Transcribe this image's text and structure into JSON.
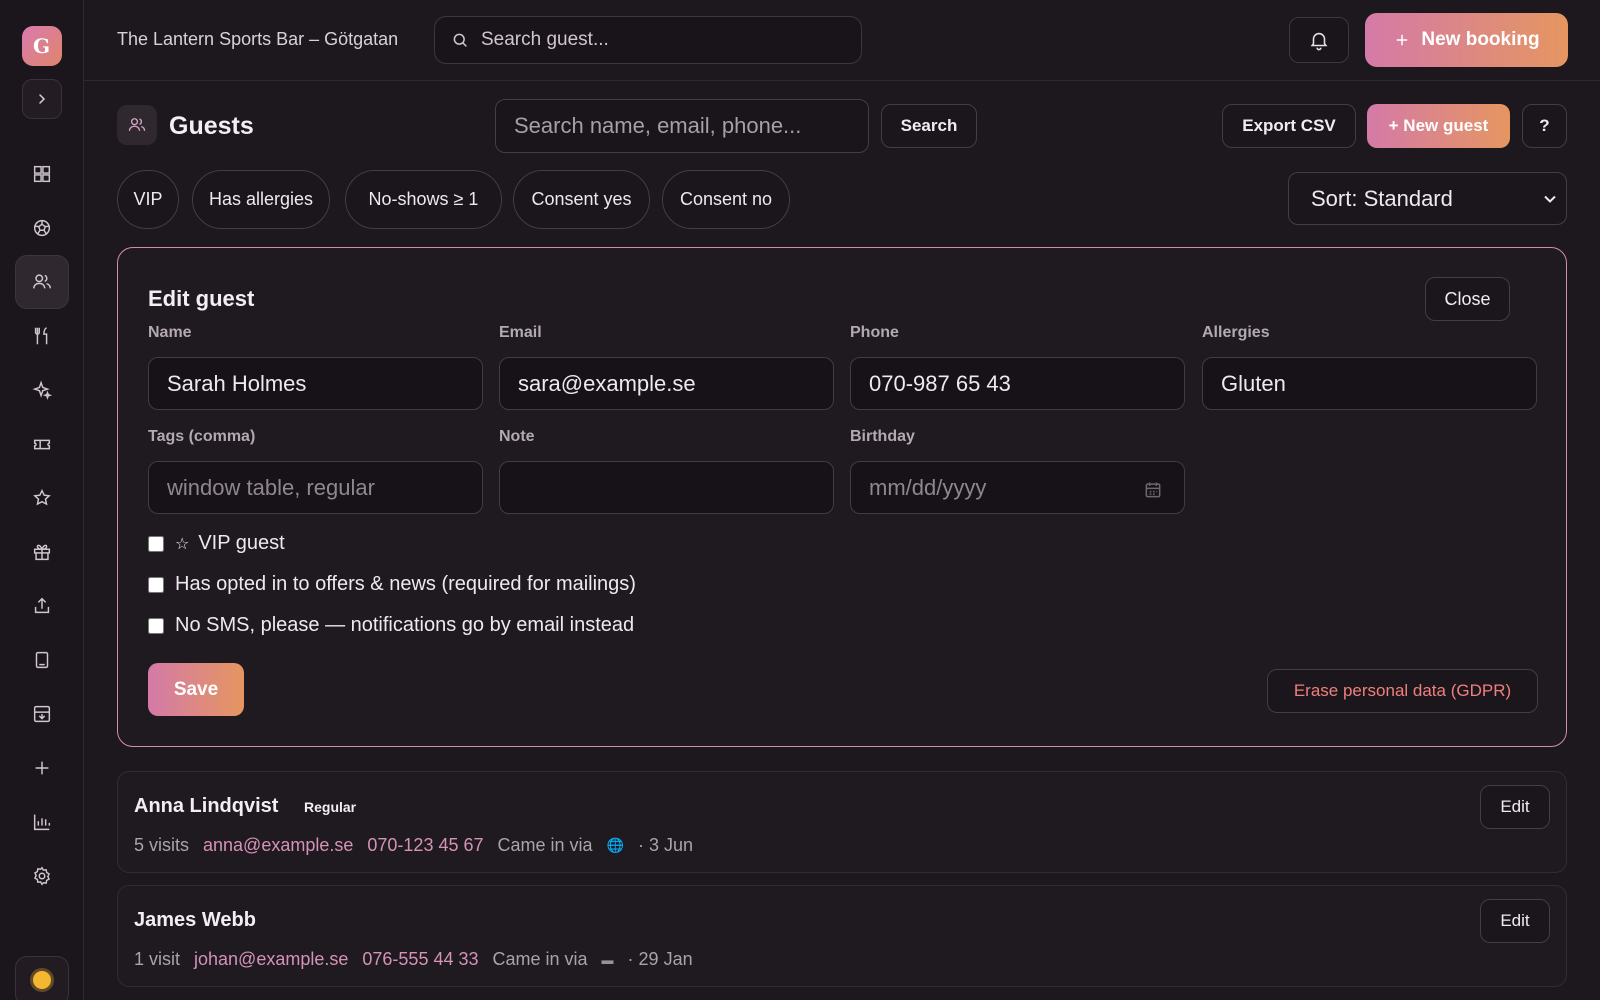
{
  "sidebar": {
    "logo_letter": "G",
    "items": [
      {
        "name": "dashboard",
        "icon": "grid-icon"
      },
      {
        "name": "sports",
        "icon": "ball-icon"
      },
      {
        "name": "guests",
        "icon": "users-icon",
        "active": true
      },
      {
        "name": "menu",
        "icon": "utensils-icon"
      },
      {
        "name": "specials",
        "icon": "sparkle-icon"
      },
      {
        "name": "tickets",
        "icon": "ticket-icon"
      },
      {
        "name": "reviews",
        "icon": "star-icon"
      },
      {
        "name": "gift-cards",
        "icon": "gift-icon"
      },
      {
        "name": "export",
        "icon": "upload-icon"
      },
      {
        "name": "tablet",
        "icon": "tablet-icon"
      },
      {
        "name": "inbox",
        "icon": "inbox-icon"
      },
      {
        "name": "add",
        "icon": "plus-icon"
      },
      {
        "name": "stats",
        "icon": "bar-chart-icon"
      },
      {
        "name": "settings",
        "icon": "gear-icon"
      }
    ]
  },
  "topbar": {
    "venue": "The Lantern Sports Bar – Götgatan",
    "search_placeholder": "Search guest...",
    "new_booking_label": "New booking"
  },
  "page": {
    "title": "Guests",
    "search_placeholder": "Search name, email, phone...",
    "search_label": "Search",
    "export_label": "Export CSV",
    "new_guest_label": "+ New guest",
    "help_label": "?"
  },
  "filters": [
    "VIP",
    "Has allergies",
    "No-shows ≥ 1",
    "Consent yes",
    "Consent no"
  ],
  "sort": {
    "selected": "Sort: Standard"
  },
  "edit_guest": {
    "title": "Edit guest",
    "close_label": "Close",
    "labels": {
      "name": "Name",
      "email": "Email",
      "phone": "Phone",
      "allergies": "Allergies",
      "tags": "Tags (comma)",
      "note": "Note",
      "birthday": "Birthday"
    },
    "values": {
      "name": "Sarah Holmes",
      "email": "sara@example.se",
      "phone": "070-987 65 43",
      "allergies": "Gluten",
      "tags": "",
      "note": "",
      "birthday": ""
    },
    "placeholders": {
      "tags": "window table, regular",
      "birthday": "mm/dd/yyyy"
    },
    "checkboxes": {
      "vip": "VIP guest",
      "consent": "Has opted in to offers & news (required for mailings)",
      "no_sms": "No SMS, please — notifications go by email instead"
    },
    "save_label": "Save",
    "erase_label": "Erase personal data (GDPR)"
  },
  "guests": [
    {
      "name": "Anna Lindqvist",
      "tag": "Regular",
      "visits": "5 visits",
      "email": "anna@example.se",
      "phone": "070-123 45 67",
      "came_via": "Came in via",
      "source_icon": "globe-icon",
      "date": "· 3 Jun",
      "edit_label": "Edit"
    },
    {
      "name": "James Webb",
      "tag": "",
      "visits": "1 visit",
      "email": "johan@example.se",
      "phone": "076-555 44 33",
      "came_via": "Came in via",
      "source_icon": "card-icon",
      "date": "· 29 Jan",
      "edit_label": "Edit"
    }
  ],
  "colors": {
    "accent_start": "#d47aa8",
    "accent_end": "#e59660",
    "danger": "#f07f7f",
    "background": "#1d181d"
  }
}
